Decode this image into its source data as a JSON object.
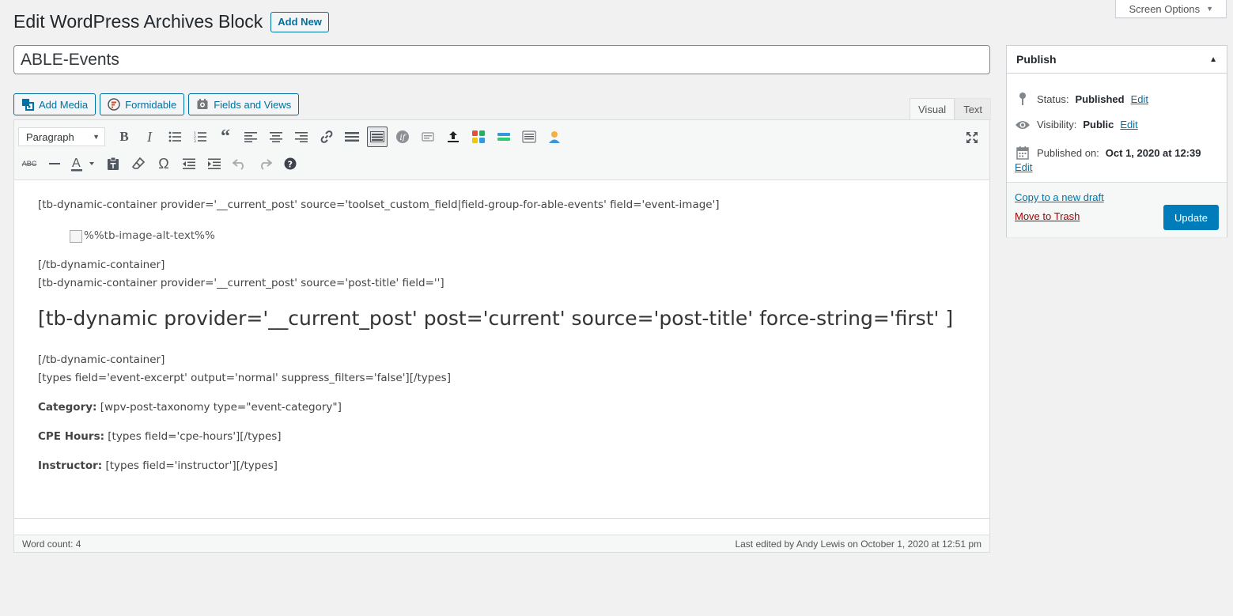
{
  "screen_options": {
    "label": "Screen Options"
  },
  "header": {
    "title": "Edit WordPress Archives Block",
    "add_new": "Add New"
  },
  "post_title": {
    "value": "ABLE-Events"
  },
  "media_buttons": [
    {
      "label": "Add Media",
      "icon": "media-icon"
    },
    {
      "label": "Formidable",
      "icon": "formidable-icon"
    },
    {
      "label": "Fields and Views",
      "icon": "fields-views-icon"
    }
  ],
  "editor_tabs": {
    "visual": "Visual",
    "text": "Text",
    "active": "visual"
  },
  "toolbar": {
    "format_select": "Paragraph"
  },
  "content": {
    "line1": "[tb-dynamic-container provider='__current_post' source='toolset_custom_field|field-group-for-able-events' field='event-image']",
    "image_alt": "%%tb-image-alt-text%%",
    "line2": "[/tb-dynamic-container]",
    "line3": "[tb-dynamic-container provider='__current_post' source='post-title' field='']",
    "heading": "[tb-dynamic provider='__current_post' post='current' source='post-title' force-string='first' ]",
    "line4": "[/tb-dynamic-container]",
    "line5": "[types field='event-excerpt' output='normal' suppress_filters='false'][/types]",
    "category_label": "Category:",
    "category_value": " [wpv-post-taxonomy type=\"event-category\"]",
    "cpe_label": "CPE Hours:",
    "cpe_value": " [types field='cpe-hours'][/types]",
    "instructor_label": "Instructor:",
    "instructor_value": " [types field='instructor'][/types]"
  },
  "status_bar": {
    "word_count": "Word count: 4",
    "last_edited": "Last edited by Andy Lewis on October 1, 2020 at 12:51 pm"
  },
  "publish_box": {
    "title": "Publish",
    "status_label": "Status:",
    "status_value": "Published",
    "visibility_label": "Visibility:",
    "visibility_value": "Public",
    "published_label": "Published on:",
    "published_value": "Oct 1, 2020 at 12:39",
    "edit": "Edit",
    "copy_draft": "Copy to a new draft",
    "trash": "Move to Trash",
    "update": "Update"
  },
  "colors": {
    "primary": "#007cba",
    "link": "#0073aa",
    "trash": "#a00"
  }
}
